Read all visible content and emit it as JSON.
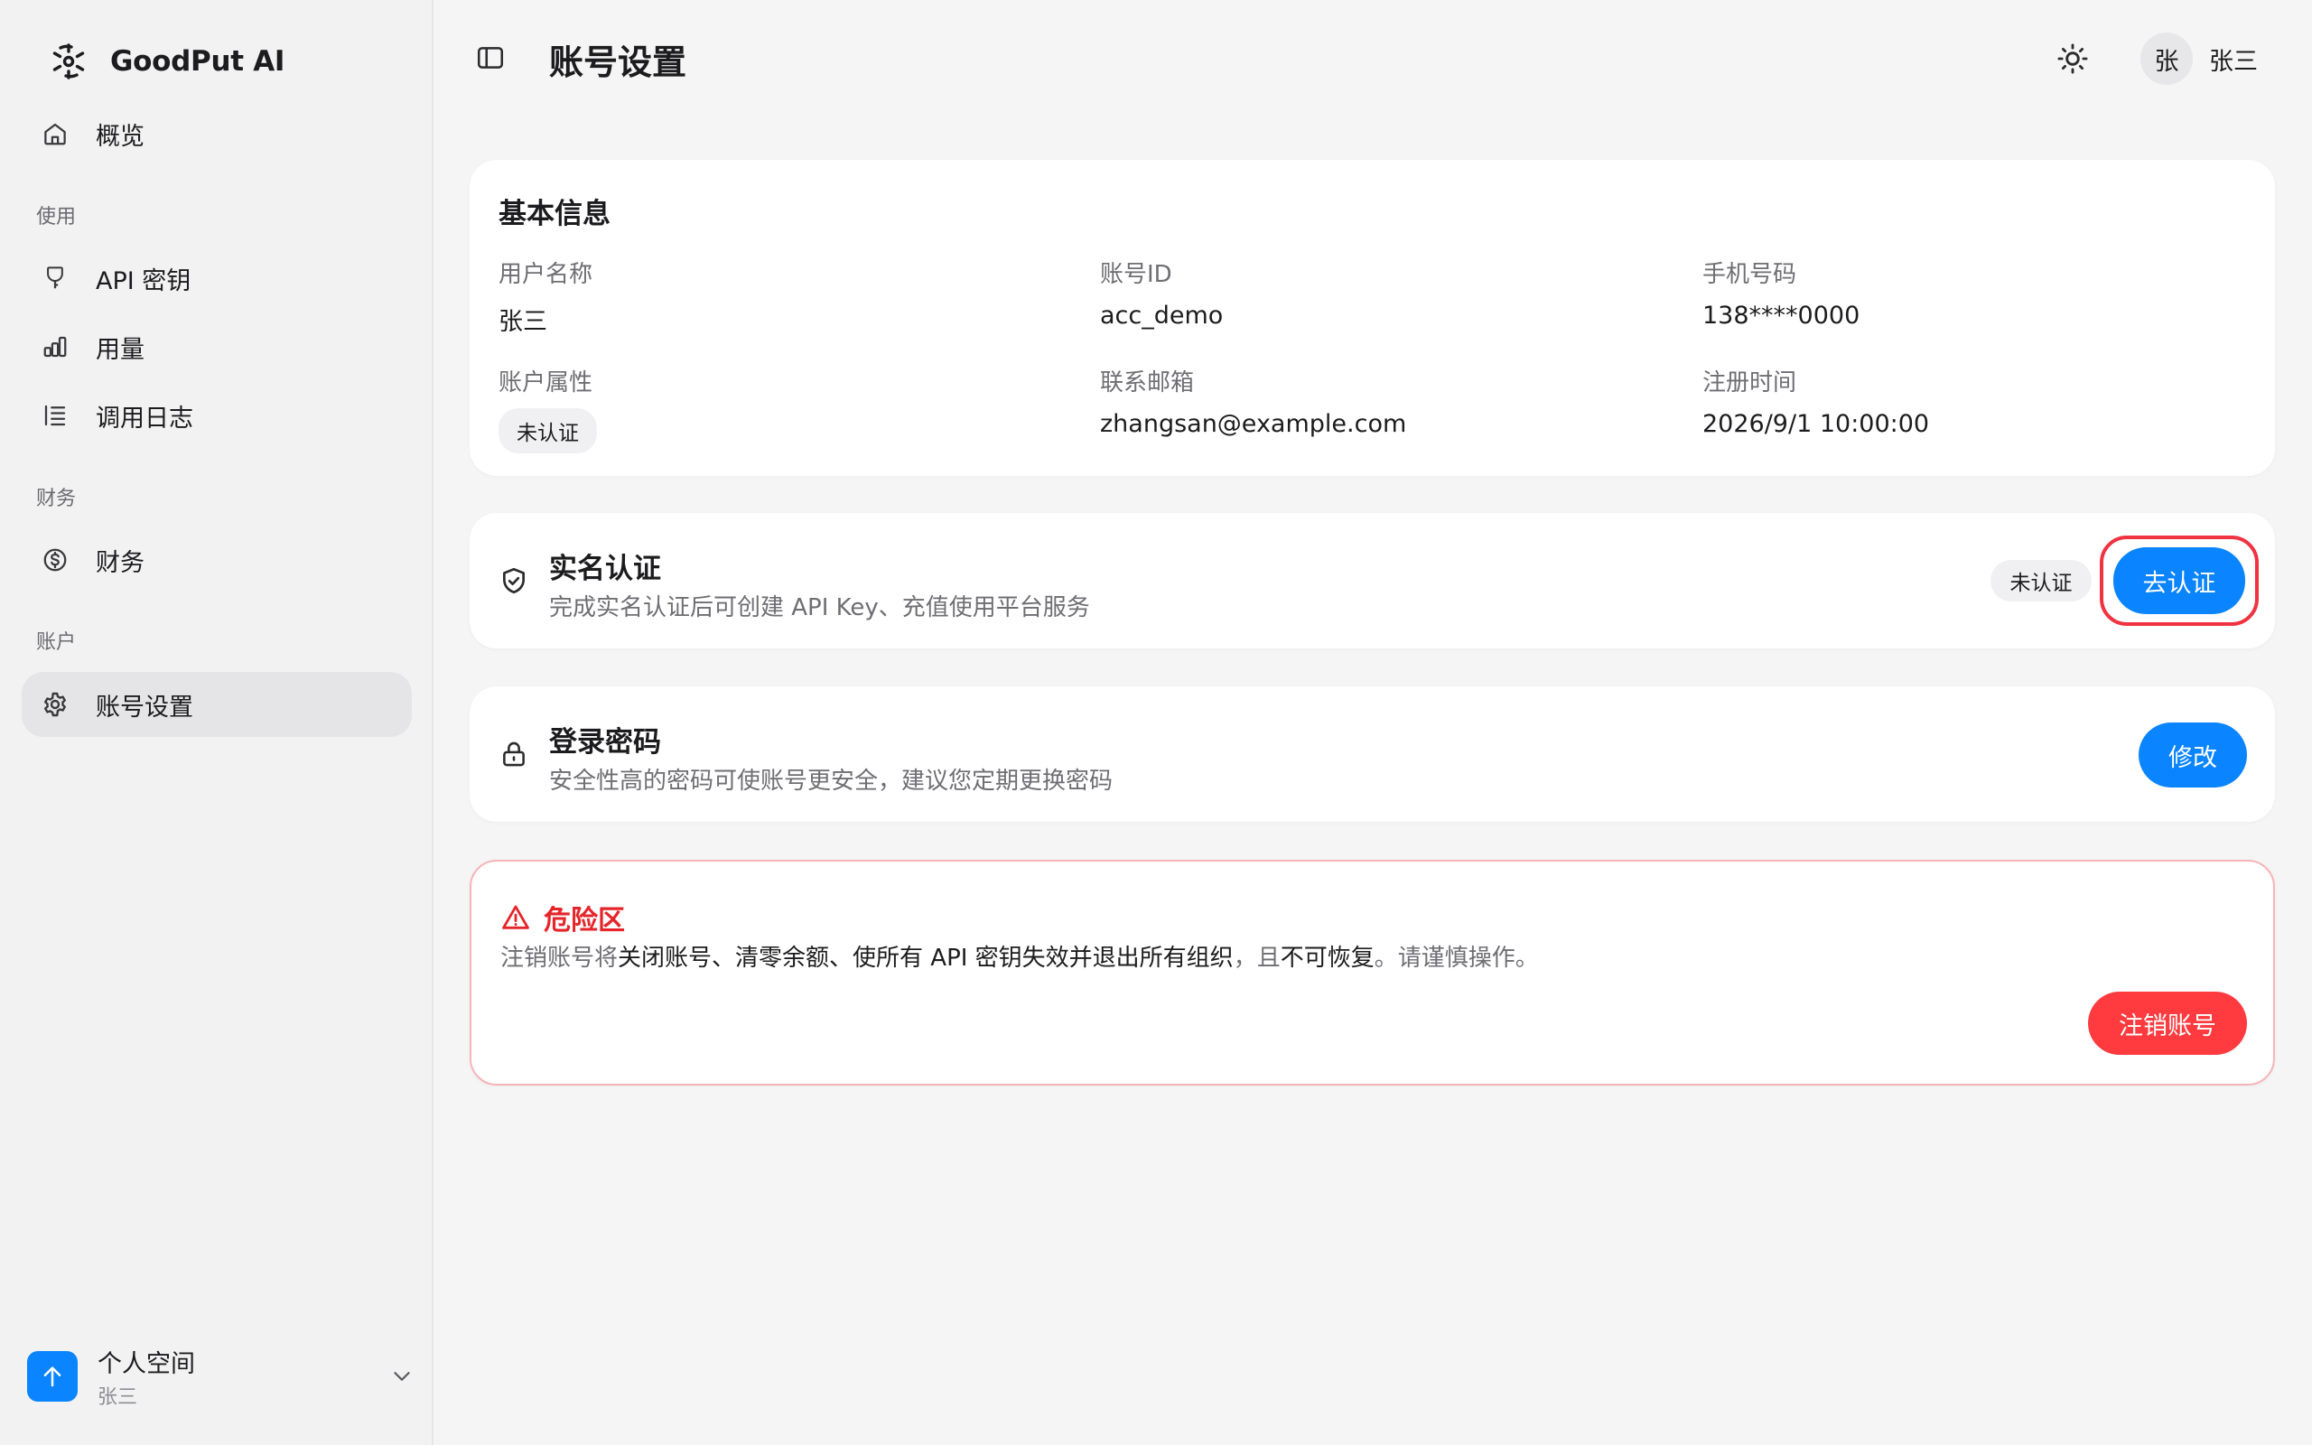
{
  "app": {
    "brand_name": "GoodPut AI"
  },
  "sidebar": {
    "overview_label": "概览",
    "groups": {
      "usage": "使用",
      "finance": "财务",
      "account": "账户"
    },
    "items": {
      "api_keys": "API 密钥",
      "usage": "用量",
      "call_logs": "调用日志",
      "finance": "财务",
      "account_settings": "账号设置"
    },
    "workspace": {
      "name": "个人空间",
      "owner": "张三"
    }
  },
  "header": {
    "title": "账号设置",
    "avatar_char": "张",
    "user_name": "张三"
  },
  "basic_info": {
    "title": "基本信息",
    "fields": {
      "username_label": "用户名称",
      "username_value": "张三",
      "account_id_label": "账号ID",
      "account_id_value": "acc_demo",
      "phone_label": "手机号码",
      "phone_value": "138****0000",
      "attribute_label": "账户属性",
      "attribute_value": "未认证",
      "email_label": "联系邮箱",
      "email_value": "zhangsan@example.com",
      "registered_label": "注册时间",
      "registered_value": "2026/9/1 10:00:00"
    }
  },
  "verification": {
    "title": "实名认证",
    "description": "完成实名认证后可创建 API Key、充值使用平台服务",
    "status": "未认证",
    "button": "去认证"
  },
  "password": {
    "title": "登录密码",
    "description": "安全性高的密码可使账号更安全，建议您定期更换密码",
    "button": "修改"
  },
  "danger": {
    "title": "危险区",
    "desc_prefix": "注销账号将",
    "desc_emphasis": "关闭账号、清零余额、使所有 API 密钥失效并退出所有组织",
    "desc_mid": "，且",
    "desc_emphasis2": "不可恢复",
    "desc_suffix": "。请谨慎操作。",
    "button": "注销账号"
  },
  "colors": {
    "accent": "#0a84ff",
    "danger": "#ff3b3f",
    "focus_ring": "#ef3340"
  }
}
